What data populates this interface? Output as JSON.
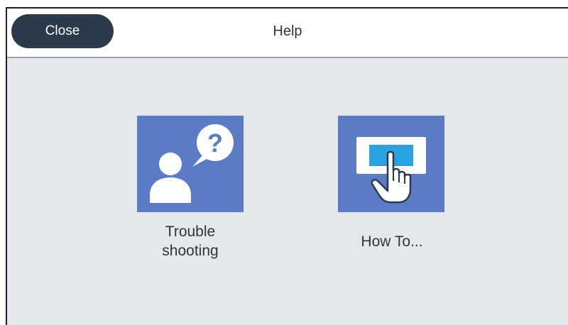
{
  "header": {
    "close_label": "Close",
    "title": "Help"
  },
  "menu": {
    "items": [
      {
        "label_line1": "Trouble",
        "label_line2": "shooting",
        "icon": "troubleshooting-icon"
      },
      {
        "label": "How To...",
        "icon": "how-to-touch-icon"
      }
    ]
  },
  "colors": {
    "tile": "#5b7bc4",
    "close_button": "#2b3a4b",
    "background": "#e4e8ec",
    "screen_highlight": "#29a3de"
  }
}
